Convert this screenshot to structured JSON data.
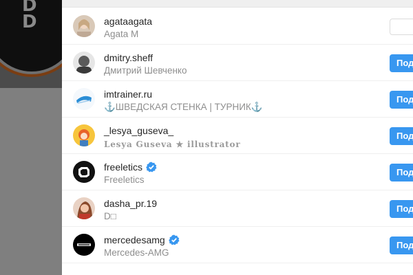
{
  "rows": [
    {
      "username": "agataagata",
      "fullname": "Agata M",
      "verified": false,
      "button": "",
      "button_style": "outline"
    },
    {
      "username": "dmitry.sheff",
      "fullname": "Дмитрий Шевченко",
      "verified": false,
      "button": "Под",
      "button_style": "primary"
    },
    {
      "username": "imtrainer.ru",
      "fullname": "⚓ШВЕДСКАЯ СТЕНКА | ТУРНИК⚓",
      "verified": false,
      "button": "Под",
      "button_style": "primary"
    },
    {
      "username": "_lesya_guseva_",
      "fullname": "Lesya Guseva ★ illustrator",
      "verified": false,
      "button": "Под",
      "button_style": "primary"
    },
    {
      "username": "freeletics",
      "fullname": "Freeletics",
      "verified": true,
      "button": "Под",
      "button_style": "primary"
    },
    {
      "username": "dasha_pr.19",
      "fullname": "D□",
      "verified": false,
      "button": "Под",
      "button_style": "primary"
    },
    {
      "username": "mercedesamg",
      "fullname": "Mercedes-AMG",
      "verified": true,
      "button": "Под",
      "button_style": "primary"
    }
  ],
  "background": {
    "logo_letters": "DD"
  },
  "colors": {
    "accent": "#3897f0",
    "verified": "#3897f0",
    "overlay": "#7f7f7f"
  }
}
